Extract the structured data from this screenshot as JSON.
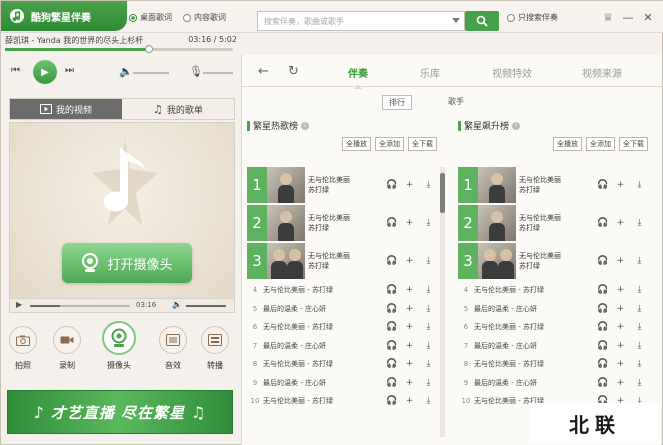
{
  "app": {
    "title": "酷狗繁星伴奏",
    "colors": {
      "accent": "#4aa24a",
      "accent_dark": "#2f8a35"
    }
  },
  "header": {
    "radio_options": [
      {
        "label": "桌面歌词",
        "selected": true
      },
      {
        "label": "内容歌词",
        "selected": false
      }
    ],
    "search": {
      "placeholder": "搜索伴奏，歌曲或歌手"
    },
    "only_accompaniment": {
      "label": "只搜索伴奏"
    },
    "window_buttons": [
      "skin-icon",
      "minimize-icon",
      "close-icon"
    ]
  },
  "player": {
    "singer": "薛凯琪",
    "song": "Yanda 我的世界的尽头上杉杆",
    "time": "03:16 / 5:02",
    "progress": 0.63
  },
  "left_tabs": [
    {
      "label": "我的视频",
      "active": true,
      "icon": "video-icon"
    },
    {
      "label": "我的歌单",
      "active": false,
      "icon": "music-note-icon"
    }
  ],
  "video": {
    "open_camera_label": "打开摄像头",
    "time": "03:16",
    "progress": 0.3
  },
  "functions": [
    {
      "label": "拍照",
      "icon": "camera-icon"
    },
    {
      "label": "录制",
      "icon": "record-icon"
    },
    {
      "label": "摄像头",
      "icon": "webcam-icon"
    },
    {
      "label": "音效",
      "icon": "equalizer-icon"
    },
    {
      "label": "转播",
      "icon": "broadcast-icon"
    }
  ],
  "banner": {
    "text": "才艺直播 尽在繁星"
  },
  "main_tabs": [
    {
      "label": "伴奏",
      "active": true
    },
    {
      "label": "乐库",
      "active": false
    },
    {
      "label": "视频特效",
      "active": false
    },
    {
      "label": "视频来源",
      "active": false
    }
  ],
  "sub_tabs": [
    {
      "label": "排行",
      "active": true
    },
    {
      "label": "歌手",
      "active": false
    }
  ],
  "panels": [
    {
      "title": "繁星热歌榜",
      "buttons": [
        "全播放",
        "全添加",
        "全下载"
      ],
      "top": [
        {
          "rank": "1",
          "song": "无与伦比美丽",
          "artist": "苏打绿"
        },
        {
          "rank": "2",
          "song": "无与伦比美丽",
          "artist": "苏打绿"
        },
        {
          "rank": "3",
          "song": "无与伦比美丽",
          "artist": "苏打绿"
        }
      ],
      "rows": [
        {
          "rank": "4",
          "title": "无与伦比美丽 - 苏打绿"
        },
        {
          "rank": "5",
          "title": "最后的温柔 - 庄心妍"
        },
        {
          "rank": "6",
          "title": "无与伦比美丽 - 苏打绿"
        },
        {
          "rank": "7",
          "title": "最后的温柔 - 庄心妍"
        },
        {
          "rank": "8",
          "title": "无与伦比美丽 - 苏打绿"
        },
        {
          "rank": "9",
          "title": "最后的温柔 - 庄心妍"
        },
        {
          "rank": "10",
          "title": "无与伦比美丽 - 苏打绿"
        }
      ]
    },
    {
      "title": "繁星飙升榜",
      "buttons": [
        "全播放",
        "全添加",
        "全下载"
      ],
      "top": [
        {
          "rank": "1",
          "song": "无与伦比美丽",
          "artist": "苏打绿"
        },
        {
          "rank": "2",
          "song": "无与伦比美丽",
          "artist": "苏打绿"
        },
        {
          "rank": "3",
          "song": "无与伦比美丽",
          "artist": "苏打绿"
        }
      ],
      "rows": [
        {
          "rank": "4",
          "title": "无与伦比美丽 - 苏打绿"
        },
        {
          "rank": "5",
          "title": "最后的温柔 - 庄心妍"
        },
        {
          "rank": "6",
          "title": "无与伦比美丽 - 苏打绿"
        },
        {
          "rank": "7",
          "title": "最后的温柔 - 庄心妍"
        },
        {
          "rank": "8",
          "title": "无与伦比美丽 - 苏打绿"
        },
        {
          "rank": "9",
          "title": "最后的温柔 - 庄心妍"
        },
        {
          "rank": "10",
          "title": "无与伦比美丽 - 苏打绿"
        }
      ]
    }
  ],
  "watermark": {
    "text": "北联"
  }
}
